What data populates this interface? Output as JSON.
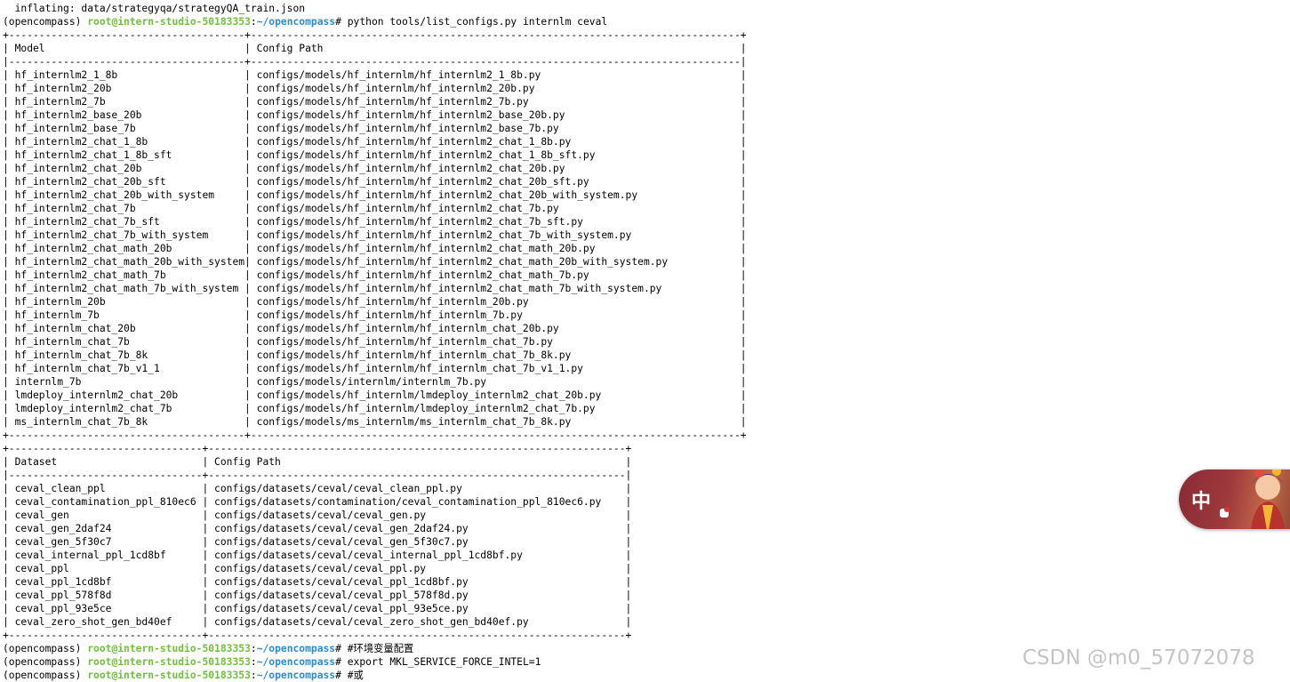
{
  "prompt": {
    "env": "(opencompass)",
    "user_host": "root@intern-studio-50183353",
    "colon": ":",
    "path": "~/opencompass",
    "dollar": "#"
  },
  "terminal": {
    "pre_output": "  inflating: data/strategyqa/strategyQA_train.json",
    "command": "python tools/list_configs.py internlm ceval",
    "models_table": {
      "border": "+---------------------------------------+---------------------------------------------------------------------------------+",
      "header": "| Model                                 | Config Path                                                                     |",
      "separator": "|---------------------------------------+---------------------------------------------------------------------------------|",
      "rows": [
        "| hf_internlm2_1_8b                     | configs/models/hf_internlm/hf_internlm2_1_8b.py                                 |",
        "| hf_internlm2_20b                      | configs/models/hf_internlm/hf_internlm2_20b.py                                  |",
        "| hf_internlm2_7b                       | configs/models/hf_internlm/hf_internlm2_7b.py                                   |",
        "| hf_internlm2_base_20b                 | configs/models/hf_internlm/hf_internlm2_base_20b.py                             |",
        "| hf_internlm2_base_7b                  | configs/models/hf_internlm/hf_internlm2_base_7b.py                              |",
        "| hf_internlm2_chat_1_8b                | configs/models/hf_internlm/hf_internlm2_chat_1_8b.py                            |",
        "| hf_internlm2_chat_1_8b_sft            | configs/models/hf_internlm/hf_internlm2_chat_1_8b_sft.py                        |",
        "| hf_internlm2_chat_20b                 | configs/models/hf_internlm/hf_internlm2_chat_20b.py                             |",
        "| hf_internlm2_chat_20b_sft             | configs/models/hf_internlm/hf_internlm2_chat_20b_sft.py                         |",
        "| hf_internlm2_chat_20b_with_system     | configs/models/hf_internlm/hf_internlm2_chat_20b_with_system.py                 |",
        "| hf_internlm2_chat_7b                  | configs/models/hf_internlm/hf_internlm2_chat_7b.py                              |",
        "| hf_internlm2_chat_7b_sft              | configs/models/hf_internlm/hf_internlm2_chat_7b_sft.py                          |",
        "| hf_internlm2_chat_7b_with_system      | configs/models/hf_internlm/hf_internlm2_chat_7b_with_system.py                  |",
        "| hf_internlm2_chat_math_20b            | configs/models/hf_internlm/hf_internlm2_chat_math_20b.py                        |",
        "| hf_internlm2_chat_math_20b_with_system| configs/models/hf_internlm/hf_internlm2_chat_math_20b_with_system.py            |",
        "| hf_internlm2_chat_math_7b             | configs/models/hf_internlm/hf_internlm2_chat_math_7b.py                         |",
        "| hf_internlm2_chat_math_7b_with_system | configs/models/hf_internlm/hf_internlm2_chat_math_7b_with_system.py             |",
        "| hf_internlm_20b                       | configs/models/hf_internlm/hf_internlm_20b.py                                   |",
        "| hf_internlm_7b                        | configs/models/hf_internlm/hf_internlm_7b.py                                    |",
        "| hf_internlm_chat_20b                  | configs/models/hf_internlm/hf_internlm_chat_20b.py                              |",
        "| hf_internlm_chat_7b                   | configs/models/hf_internlm/hf_internlm_chat_7b.py                               |",
        "| hf_internlm_chat_7b_8k                | configs/models/hf_internlm/hf_internlm_chat_7b_8k.py                            |",
        "| hf_internlm_chat_7b_v1_1              | configs/models/hf_internlm/hf_internlm_chat_7b_v1_1.py                          |",
        "| internlm_7b                           | configs/models/internlm/internlm_7b.py                                          |",
        "| lmdeploy_internlm2_chat_20b           | configs/models/hf_internlm/lmdeploy_internlm2_chat_20b.py                       |",
        "| lmdeploy_internlm2_chat_7b            | configs/models/hf_internlm/lmdeploy_internlm2_chat_7b.py                        |",
        "| ms_internlm_chat_7b_8k                | configs/models/ms_internlm/ms_internlm_chat_7b_8k.py                            |"
      ]
    },
    "datasets_table": {
      "border": "+--------------------------------+---------------------------------------------------------------------+",
      "header": "| Dataset                        | Config Path                                                         |",
      "separator": "|--------------------------------+---------------------------------------------------------------------|",
      "rows": [
        "| ceval_clean_ppl                | configs/datasets/ceval/ceval_clean_ppl.py                           |",
        "| ceval_contamination_ppl_810ec6 | configs/datasets/contamination/ceval_contamination_ppl_810ec6.py    |",
        "| ceval_gen                      | configs/datasets/ceval/ceval_gen.py                                 |",
        "| ceval_gen_2daf24               | configs/datasets/ceval/ceval_gen_2daf24.py                          |",
        "| ceval_gen_5f30c7               | configs/datasets/ceval/ceval_gen_5f30c7.py                          |",
        "| ceval_internal_ppl_1cd8bf      | configs/datasets/ceval/ceval_internal_ppl_1cd8bf.py                 |",
        "| ceval_ppl                      | configs/datasets/ceval/ceval_ppl.py                                 |",
        "| ceval_ppl_1cd8bf               | configs/datasets/ceval/ceval_ppl_1cd8bf.py                          |",
        "| ceval_ppl_578f8d               | configs/datasets/ceval/ceval_ppl_578f8d.py                          |",
        "| ceval_ppl_93e5ce               | configs/datasets/ceval/ceval_ppl_93e5ce.py                          |",
        "| ceval_zero_shot_gen_bd40ef     | configs/datasets/ceval/ceval_zero_shot_gen_bd40ef.py                |"
      ]
    },
    "trailing_commands": [
      "#环境变量配置",
      "export MKL_SERVICE_FORCE_INTEL=1",
      "#或"
    ]
  },
  "float_widget": {
    "glyph": "中",
    "accent": "#8a2a33"
  },
  "watermark": "CSDN @m0_57072078"
}
